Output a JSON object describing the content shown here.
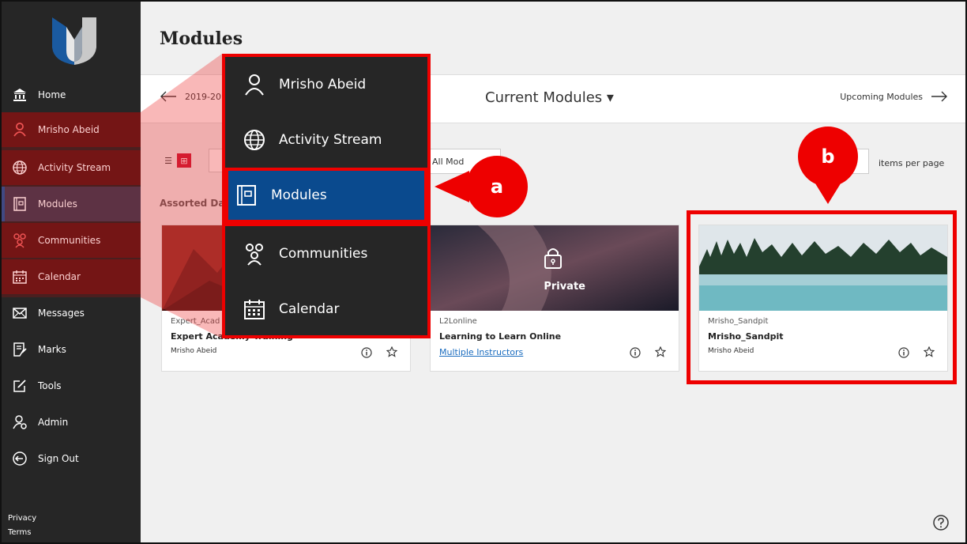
{
  "sidebar": {
    "items": [
      {
        "label": "Home",
        "icon": "institution-icon"
      },
      {
        "label": "Mrisho Abeid",
        "icon": "user-icon"
      },
      {
        "label": "Activity Stream",
        "icon": "globe-icon"
      },
      {
        "label": "Modules",
        "icon": "modules-icon"
      },
      {
        "label": "Communities",
        "icon": "communities-icon"
      },
      {
        "label": "Calendar",
        "icon": "calendar-icon"
      },
      {
        "label": "Messages",
        "icon": "envelope-icon"
      },
      {
        "label": "Marks",
        "icon": "marks-icon"
      },
      {
        "label": "Tools",
        "icon": "tools-icon"
      },
      {
        "label": "Admin",
        "icon": "admin-icon"
      },
      {
        "label": "Sign Out",
        "icon": "sign-out-icon"
      }
    ],
    "footer": {
      "privacy": "Privacy",
      "terms": "Terms"
    }
  },
  "header": {
    "title": "Modules"
  },
  "term_nav": {
    "prev": "2019-20",
    "current": "Current Modules ▾",
    "next": "Upcoming Modules"
  },
  "toolbar": {
    "filter_value": "All Mod",
    "per_page_label": "items per page"
  },
  "section_title": "Assorted Da",
  "cards": [
    {
      "id": "Expert_Acad",
      "title": "Expert Academy Training",
      "instructor": "Mrisho Abeid"
    },
    {
      "id": "L2Lonline",
      "title": "Learning to Learn Online",
      "instructor": "Multiple Instructors",
      "overlay": "Private"
    },
    {
      "id": "Mrisho_Sandpit",
      "title": "Mrisho_Sandpit",
      "instructor": "Mrisho Abeid"
    }
  ],
  "zoom_menu": {
    "items": [
      {
        "label": "Mrisho Abeid",
        "icon": "user-icon"
      },
      {
        "label": "Activity Stream",
        "icon": "globe-icon"
      },
      {
        "label": "Modules",
        "icon": "modules-icon"
      },
      {
        "label": "Communities",
        "icon": "communities-icon"
      },
      {
        "label": "Calendar",
        "icon": "calendar-icon"
      }
    ]
  },
  "callouts": {
    "a": "a",
    "b": "b"
  },
  "colors": {
    "sidebar": "#262626",
    "active": "#0a4a8e",
    "highlight": "#e00000",
    "grid_toggle": "#c8102e"
  }
}
